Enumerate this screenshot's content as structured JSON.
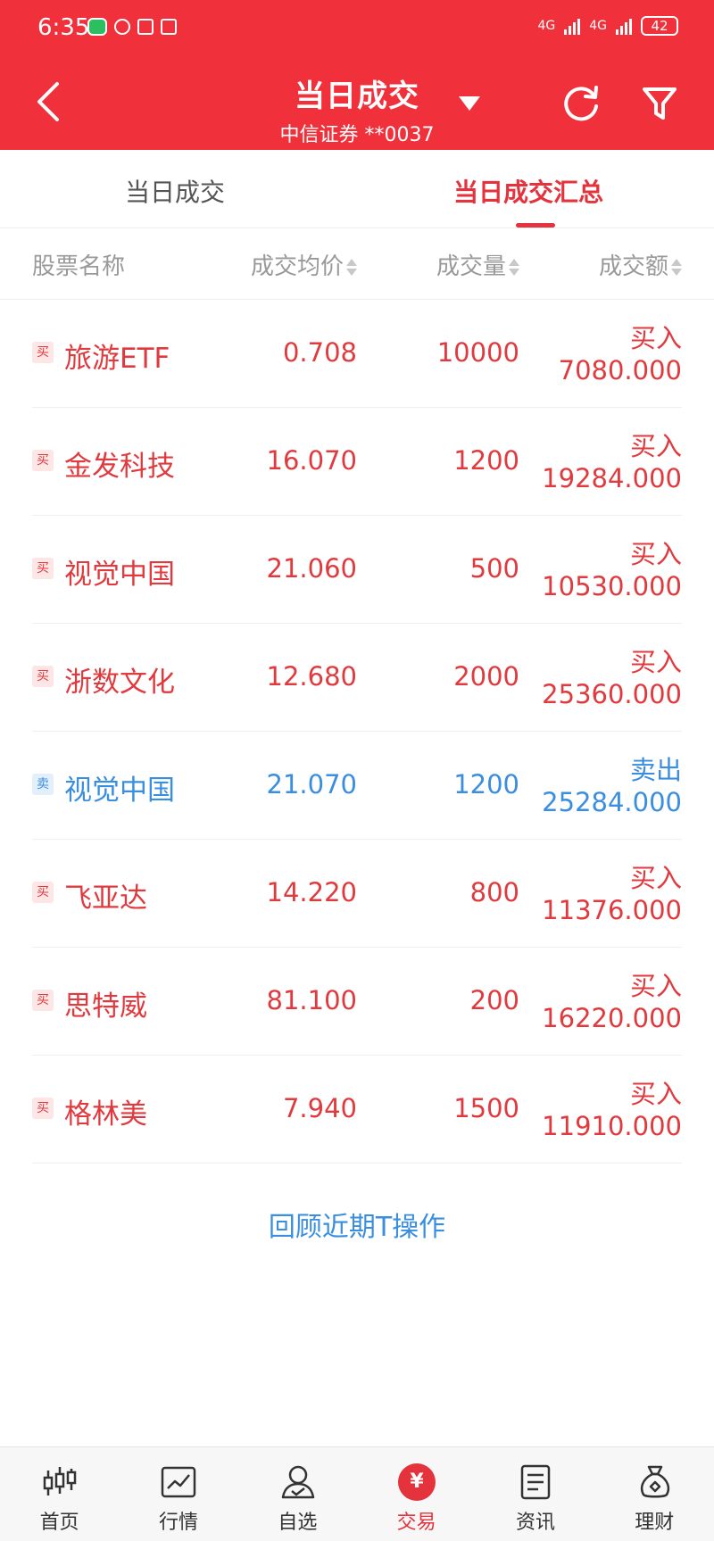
{
  "status_bar": {
    "time": "6:35",
    "network_1": "4G",
    "network_2": "4G",
    "battery": "42"
  },
  "header": {
    "title": "当日成交",
    "subtitle": "中信证券 **0037",
    "back_icon": "chevron-left-icon",
    "refresh_icon": "refresh-icon",
    "filter_icon": "filter-icon",
    "bg_color": "#f0303a"
  },
  "tabs": [
    {
      "label": "当日成交",
      "active": false
    },
    {
      "label": "当日成交汇总",
      "active": true
    }
  ],
  "columns": {
    "name": "股票名称",
    "price": "成交均价",
    "volume": "成交量",
    "amount": "成交额"
  },
  "rows": [
    {
      "tag": "买",
      "name": "旅游ETF",
      "price": "0.708",
      "volume": "10000",
      "side": "买入",
      "amount": "7080.000",
      "type": "buy"
    },
    {
      "tag": "买",
      "name": "金发科技",
      "price": "16.070",
      "volume": "1200",
      "side": "买入",
      "amount": "19284.000",
      "type": "buy"
    },
    {
      "tag": "买",
      "name": "视觉中国",
      "price": "21.060",
      "volume": "500",
      "side": "买入",
      "amount": "10530.000",
      "type": "buy"
    },
    {
      "tag": "买",
      "name": "浙数文化",
      "price": "12.680",
      "volume": "2000",
      "side": "买入",
      "amount": "25360.000",
      "type": "buy"
    },
    {
      "tag": "卖",
      "name": "视觉中国",
      "price": "21.070",
      "volume": "1200",
      "side": "卖出",
      "amount": "25284.000",
      "type": "sell"
    },
    {
      "tag": "买",
      "name": "飞亚达",
      "price": "14.220",
      "volume": "800",
      "side": "买入",
      "amount": "11376.000",
      "type": "buy"
    },
    {
      "tag": "买",
      "name": "思特威",
      "price": "81.100",
      "volume": "200",
      "side": "买入",
      "amount": "16220.000",
      "type": "buy"
    },
    {
      "tag": "买",
      "name": "格林美",
      "price": "7.940",
      "volume": "1500",
      "side": "买入",
      "amount": "11910.000",
      "type": "buy"
    }
  ],
  "review_link": "回顾近期T操作",
  "bottom_nav": [
    {
      "label": "首页",
      "icon": "candlestick-icon",
      "active": false
    },
    {
      "label": "行情",
      "icon": "chart-icon",
      "active": false
    },
    {
      "label": "自选",
      "icon": "user-check-icon",
      "active": false
    },
    {
      "label": "交易",
      "icon": "yen-icon",
      "active": true,
      "glyph": "¥"
    },
    {
      "label": "资讯",
      "icon": "document-icon",
      "active": false
    },
    {
      "label": "理财",
      "icon": "money-bag-icon",
      "active": false
    }
  ],
  "colors": {
    "buy": "#e03a3e",
    "sell": "#3a8ee0",
    "accent": "#e4333c"
  }
}
